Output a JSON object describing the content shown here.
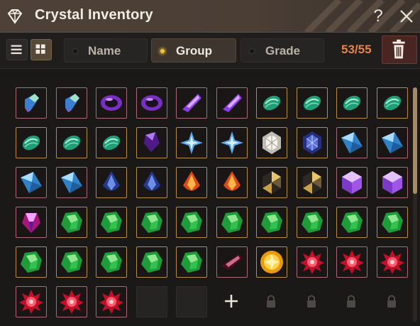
{
  "window": {
    "title": "Crystal Inventory",
    "help_label": "?"
  },
  "toolbar": {
    "view_modes": [
      {
        "name": "list-view",
        "icon": "list-icon",
        "active": false
      },
      {
        "name": "grid-view",
        "icon": "grid-icon",
        "active": true
      }
    ],
    "sort_tabs": [
      {
        "label": "Name",
        "active": false
      },
      {
        "label": "Group",
        "active": true
      },
      {
        "label": "Grade",
        "active": false
      }
    ],
    "capacity": "53/55",
    "trash_icon": "trash-icon"
  },
  "inventory": {
    "rows": [
      [
        "prism-blue-rough",
        "prism-blue-rough",
        "ring-purple",
        "ring-purple",
        "shard-purple",
        "shard-purple",
        "oval-teal",
        "oval-teal",
        "oval-teal",
        "oval-teal"
      ],
      [
        "oval-teal",
        "oval-teal",
        "oval-teal",
        "gem-dark-purple",
        "star-blue",
        "star-blue",
        "hex-white",
        "hex-navy",
        "crystal-blue",
        "crystal-blue"
      ],
      [
        "crystal-blue",
        "crystal-blue",
        "drop-navy",
        "drop-navy",
        "drop-orange",
        "drop-orange",
        "hex-gold-dark",
        "hex-gold-dark",
        "cube-violet",
        "cube-violet"
      ],
      [
        "gem-magenta",
        "green-round",
        "green-round",
        "green-round",
        "green-round",
        "green-round",
        "green-round",
        "green-round",
        "green-round",
        "green-round"
      ],
      [
        "green-round",
        "green-round",
        "green-round",
        "green-round",
        "green-round",
        "shard-crimson",
        "sun-yellow",
        "flower-red",
        "flower-red",
        "flower-red"
      ],
      [
        "flower-red",
        "flower-red",
        "flower-red",
        "empty",
        "empty",
        "add",
        "locked",
        "locked",
        "locked",
        "locked"
      ]
    ],
    "gold_frames": [
      [
        0,
        6
      ],
      [
        0,
        7
      ],
      [
        0,
        8
      ],
      [
        0,
        9
      ],
      [
        1,
        0
      ],
      [
        1,
        1
      ],
      [
        1,
        2
      ],
      [
        1,
        3
      ],
      [
        1,
        4
      ],
      [
        1,
        5
      ],
      [
        1,
        6
      ],
      [
        1,
        7
      ],
      [
        2,
        2
      ],
      [
        2,
        3
      ],
      [
        2,
        4
      ],
      [
        2,
        5
      ],
      [
        2,
        6
      ],
      [
        2,
        7
      ],
      [
        3,
        1
      ],
      [
        3,
        2
      ],
      [
        3,
        3
      ],
      [
        3,
        4
      ],
      [
        3,
        5
      ],
      [
        3,
        6
      ],
      [
        3,
        7
      ],
      [
        3,
        8
      ],
      [
        3,
        9
      ],
      [
        4,
        0
      ],
      [
        4,
        1
      ],
      [
        4,
        2
      ],
      [
        4,
        3
      ],
      [
        4,
        4
      ],
      [
        4,
        6
      ]
    ],
    "add_icon": "plus-icon",
    "lock_icon": "lock-icon"
  },
  "colors": {
    "accent": "#f0c33c",
    "capacity": "#e8844a",
    "frame_rose": "#a86a76",
    "frame_gold": "#b48d49"
  }
}
